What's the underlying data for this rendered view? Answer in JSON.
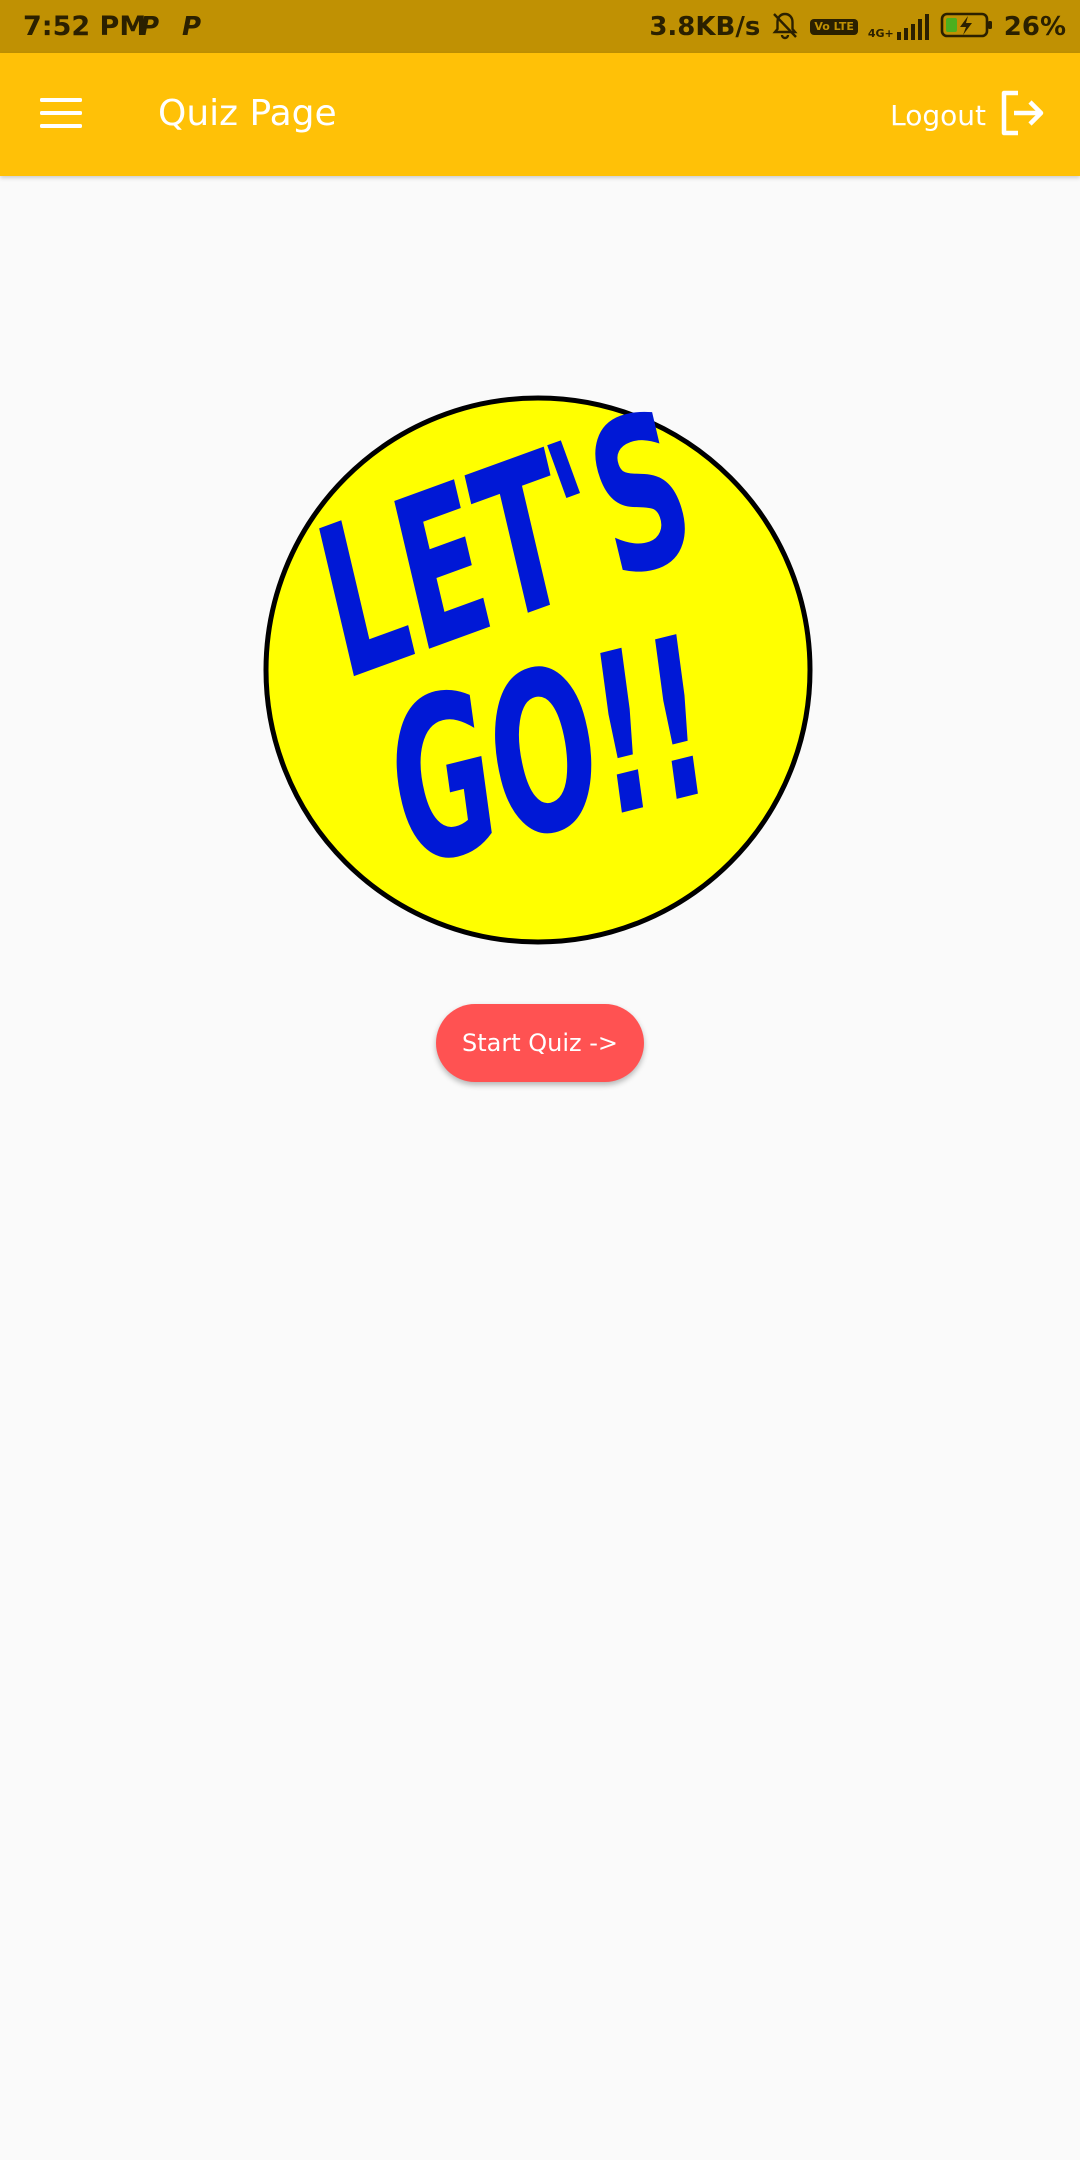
{
  "status_bar": {
    "time": "7:52 PM",
    "notification_letter": "P",
    "network_speed": "3.8KB/s",
    "volte_label": "Vo LTE",
    "signal_label": "4G+",
    "battery_percent": "26%"
  },
  "app_bar": {
    "title": "Quiz Page",
    "logout_label": "Logout",
    "background_color": "#ffc107"
  },
  "main": {
    "badge_text_line1": "LET'S",
    "badge_text_line2": "GO!!",
    "badge_fill_color": "#ffff00",
    "badge_text_color": "#0018d6",
    "start_button_label": "Start Quiz ->",
    "start_button_color": "#ff5252"
  },
  "icons": {
    "menu": "hamburger-menu-icon",
    "logout": "logout-icon",
    "mute": "bell-muted-icon",
    "signal": "signal-strength-icon",
    "battery": "battery-charging-icon"
  }
}
